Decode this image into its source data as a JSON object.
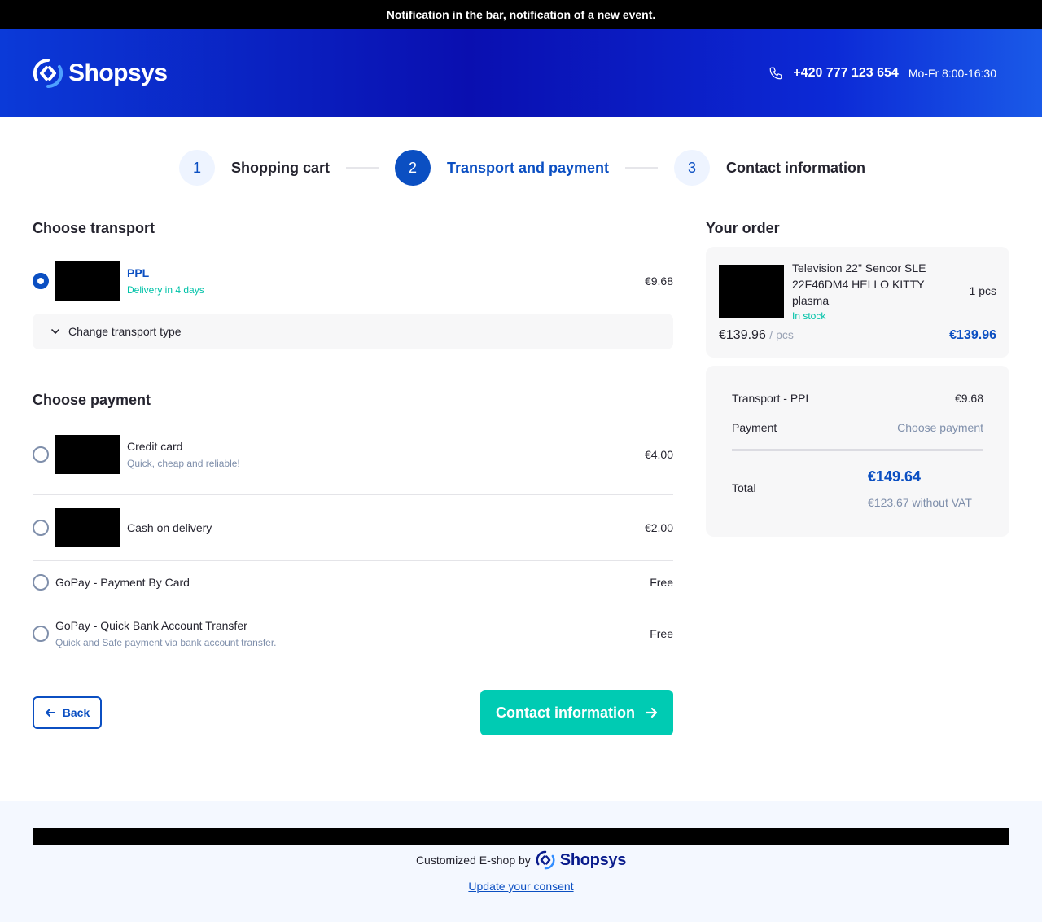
{
  "notification": "Notification in the bar, notification of a new event.",
  "header": {
    "logo_text": "Shopsys",
    "phone": "+420 777 123 654",
    "hours": "Mo-Fr 8:00-16:30"
  },
  "steps": [
    {
      "number": "1",
      "label": "Shopping cart"
    },
    {
      "number": "2",
      "label": "Transport and payment"
    },
    {
      "number": "3",
      "label": "Contact information"
    }
  ],
  "transport": {
    "title": "Choose transport",
    "selected": {
      "name": "PPL",
      "sub": "Delivery in 4 days",
      "price": "€9.68"
    },
    "change_label": "Change transport type"
  },
  "payment": {
    "title": "Choose payment",
    "options": [
      {
        "name": "Credit card",
        "sub": "Quick, cheap and reliable!",
        "price": "€4.00"
      },
      {
        "name": "Cash on delivery",
        "sub": "",
        "price": "€2.00"
      },
      {
        "name": "GoPay - Payment By Card",
        "sub": "",
        "price": "Free"
      },
      {
        "name": "GoPay - Quick Bank Account Transfer",
        "sub": "Quick and Safe payment via bank account transfer.",
        "price": "Free"
      }
    ]
  },
  "buttons": {
    "back": "Back",
    "next": "Contact information"
  },
  "order": {
    "title": "Your order",
    "product": {
      "name": "Television 22\" Sencor SLE 22F46DM4 HELLO KITTY plasma",
      "stock": "In stock",
      "qty": "1 pcs",
      "unit_price": "€139.96",
      "unit": "/ pcs",
      "total": "€139.96"
    },
    "summary": {
      "transport_label": "Transport - PPL",
      "transport_price": "€9.68",
      "payment_label": "Payment",
      "payment_value": "Choose payment",
      "total_label": "Total",
      "total_value": "€149.64",
      "total_without_vat": "€123.67 without VAT"
    }
  },
  "footer": {
    "customized": "Customized E-shop by",
    "logo_text": "Shopsys",
    "consent": "Update your consent"
  },
  "colors": {
    "primary": "#0b4fc2",
    "accent": "#00cbb3",
    "success": "#00c2a8"
  }
}
